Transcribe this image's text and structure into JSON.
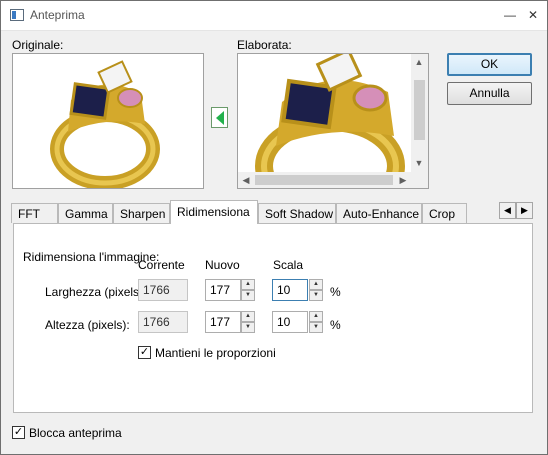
{
  "window": {
    "title": "Anteprima",
    "minimize": "—",
    "close": "✕"
  },
  "labels": {
    "original": "Originale:",
    "processed": "Elaborata:"
  },
  "buttons": {
    "ok": "OK",
    "cancel": "Annulla"
  },
  "tabs": [
    "FFT",
    "Gamma",
    "Sharpen",
    "Ridimensiona",
    "Soft Shadow",
    "Auto-Enhance",
    "Crop"
  ],
  "active_tab": "Ridimensiona",
  "resize": {
    "group_label": "Ridimensiona l'immagine:",
    "col_current": "Corrente",
    "col_new": "Nuovo",
    "col_scale": "Scala",
    "width_label": "Larghezza (pixels):",
    "height_label": "Altezza (pixels):",
    "width_current": "1766",
    "width_new": "177",
    "width_scale": "10",
    "height_current": "1766",
    "height_new": "177",
    "height_scale": "10",
    "percent": "%",
    "keep_proportions": "Mantieni le proporzioni",
    "keep_proportions_checked": true
  },
  "footer": {
    "lock_preview": "Blocca anteprima",
    "lock_preview_checked": true
  },
  "icons": {
    "left_arrow": "green-left-arrow-icon",
    "app": "app-window-icon"
  }
}
